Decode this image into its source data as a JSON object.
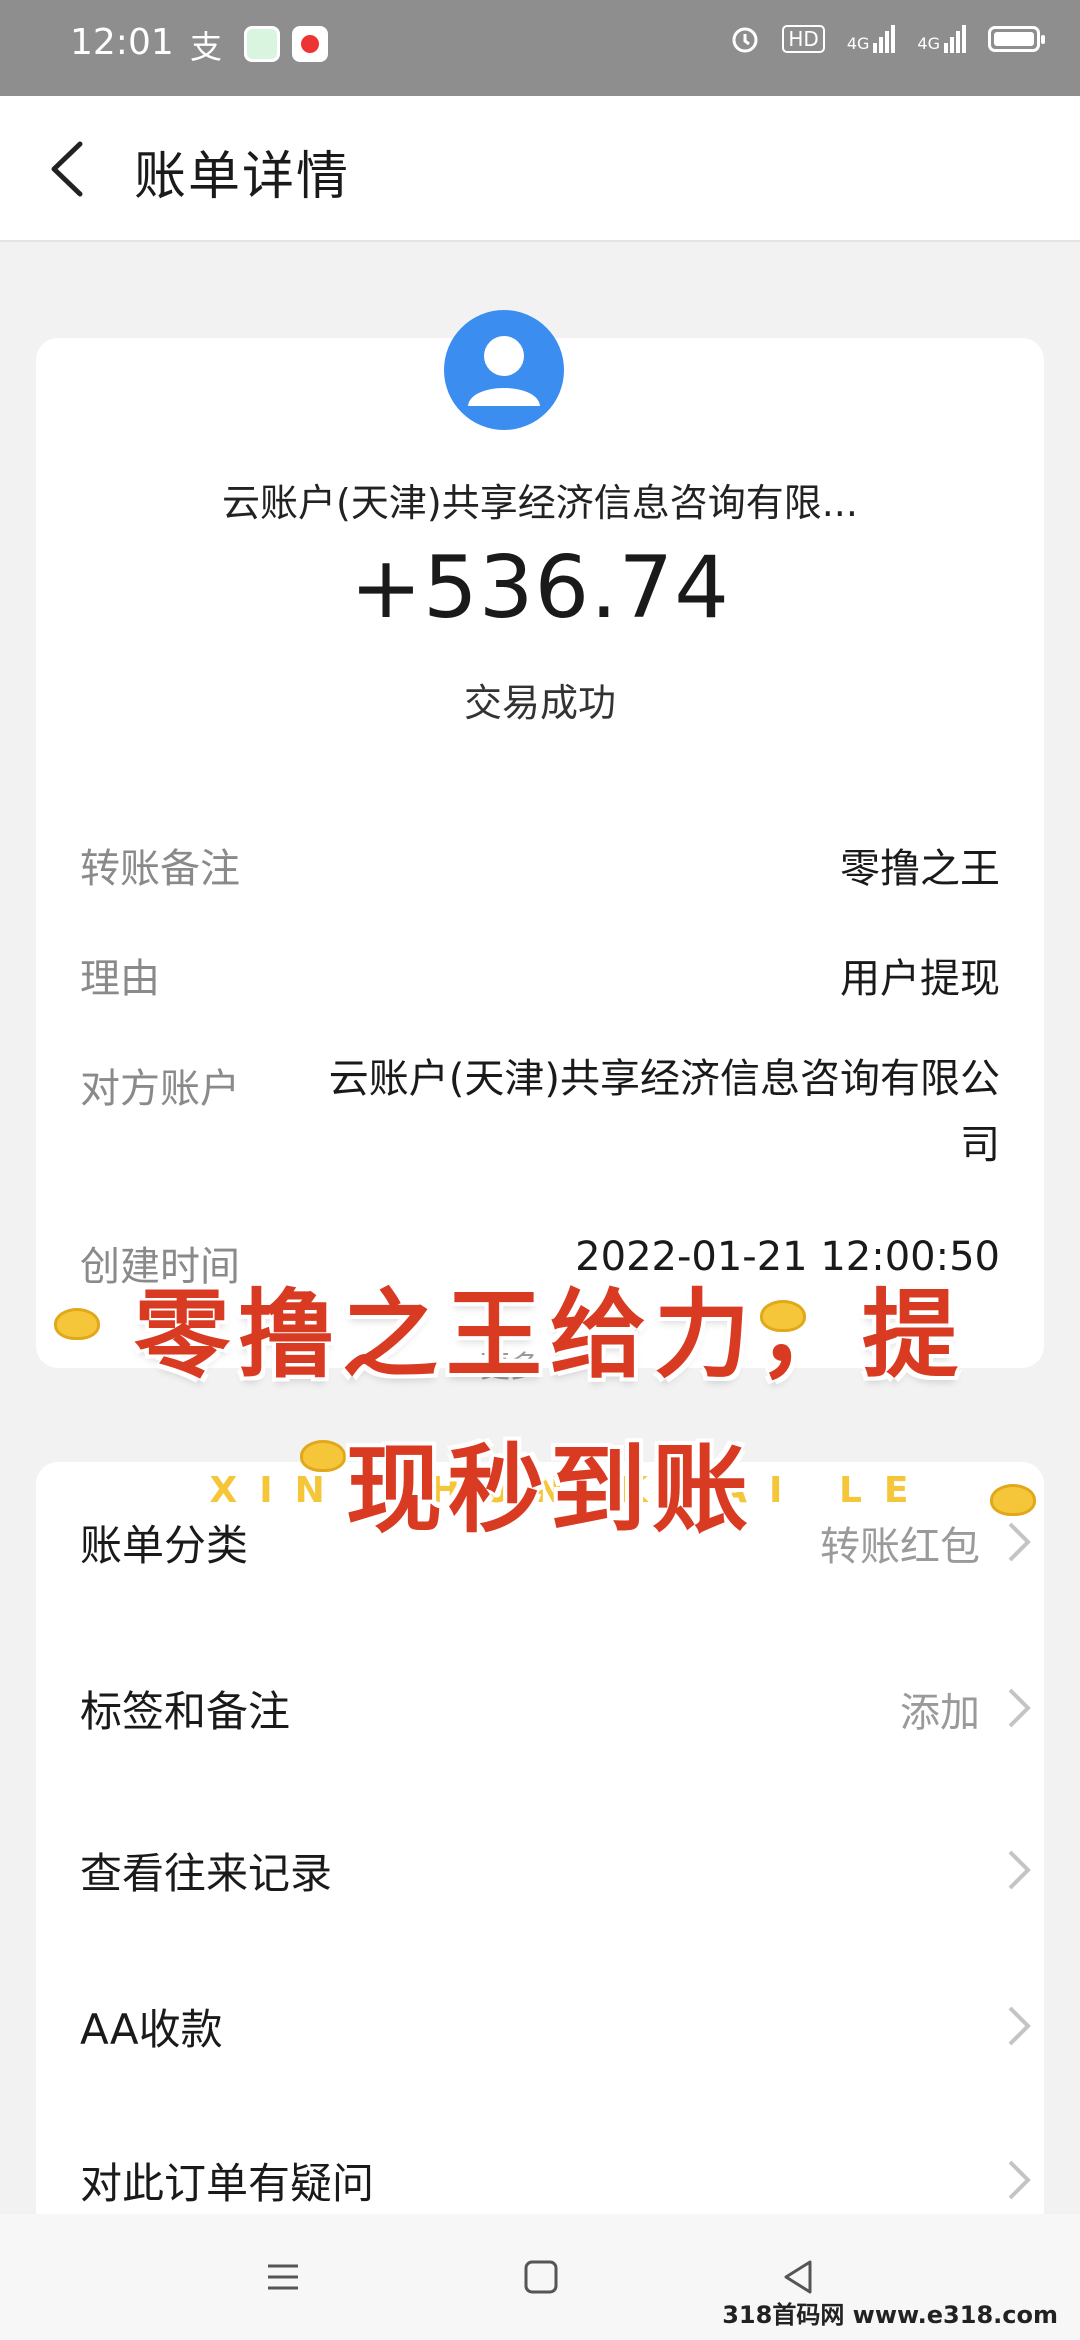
{
  "status_bar": {
    "time": "12:01",
    "app_icons": [
      "alipay-icon",
      "wechat-icon",
      "record-icon"
    ],
    "indicators": [
      "alarm-icon",
      "HD",
      "4G",
      "4G",
      "battery-icon"
    ]
  },
  "header": {
    "back_icon": "chevron-left-icon",
    "title": "账单详情"
  },
  "summary": {
    "payer": "云账户(天津)共享经济信息咨询有限...",
    "amount": "+536.74",
    "status": "交易成功"
  },
  "details": [
    {
      "label": "转账备注",
      "value": "零撸之王"
    },
    {
      "label": "理由",
      "value": "用户提现"
    },
    {
      "label": "对方账户",
      "value": "云账户(天津)共享经济信息咨询有限公司"
    },
    {
      "label": "创建时间",
      "value": "2022-01-21 12:00:50"
    }
  ],
  "more_label": "更多",
  "promo": {
    "line1": "零撸之王给力，提",
    "line2": "现秒到账",
    "english": "XIN CHUN KUAI LE"
  },
  "actions": [
    {
      "label": "账单分类",
      "value": "转账红包"
    },
    {
      "label": "标签和备注",
      "value": "添加"
    },
    {
      "label": "查看往来记录",
      "value": ""
    },
    {
      "label": "AA收款",
      "value": ""
    },
    {
      "label": "对此订单有疑问",
      "value": ""
    }
  ],
  "nav_bar": {
    "menu_icon": "menu-icon",
    "home_icon": "home-icon",
    "back_icon": "back-triangle-icon"
  },
  "site_watermark": "318首码网 www.e318.com",
  "colors": {
    "accent_blue": "#3b8df0",
    "promo_red": "#d83a22",
    "promo_gold": "#f6c63a",
    "status_bar": "#8e8e8e"
  }
}
